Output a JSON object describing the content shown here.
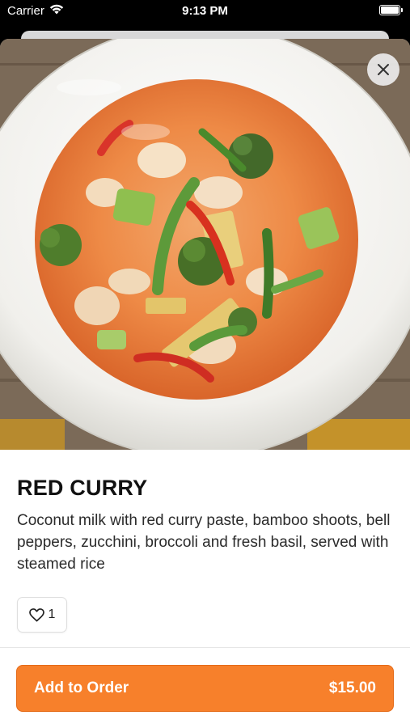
{
  "status_bar": {
    "carrier": "Carrier",
    "time": "9:13 PM",
    "wifi_icon": "wifi-icon",
    "battery_icon": "battery-icon"
  },
  "item": {
    "image_description": "bowl of red curry with broccoli, zucchini, bamboo shoots and red peppers",
    "name": "RED CURRY",
    "description": "Coconut milk with red curry paste, bamboo shoots, bell peppers, zucchini, broccoli and fresh basil, served with steamed rice",
    "likes": "1",
    "price": "$15.00"
  },
  "actions": {
    "close_icon": "close-icon",
    "like_icon": "heart-icon",
    "add_label": "Add to Order"
  },
  "colors": {
    "accent": "#f7802b",
    "text": "#111111"
  }
}
